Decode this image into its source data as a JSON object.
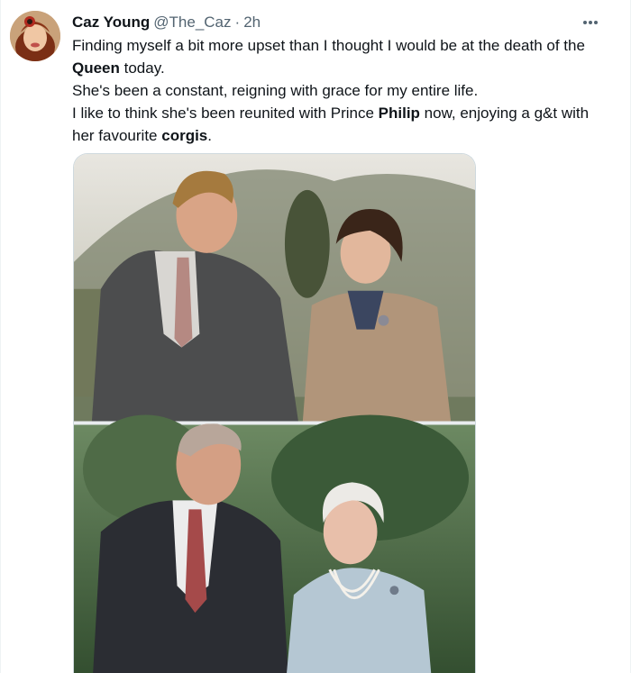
{
  "tweet": {
    "display_name": "Caz Young",
    "handle": "@The_Caz",
    "separator": "·",
    "time": "2h",
    "more_label": "•••",
    "lines": [
      {
        "pre": "Finding myself a bit more upset than I thought I would be at the death of the ",
        "bold": "Queen",
        "post": " today."
      },
      {
        "pre": "She's been a constant, reigning with grace for my entire life.",
        "bold": "",
        "post": ""
      },
      {
        "pre": "I like to think she's been reunited with Prince ",
        "bold": "Philip",
        "post": " now, enjoying a g&t with her favourite "
      },
      {
        "pre": "",
        "bold": "corgis",
        "post": "."
      }
    ]
  },
  "colors": {
    "text": "#0f1419",
    "secondary": "#536471",
    "border": "#cfd9de"
  }
}
